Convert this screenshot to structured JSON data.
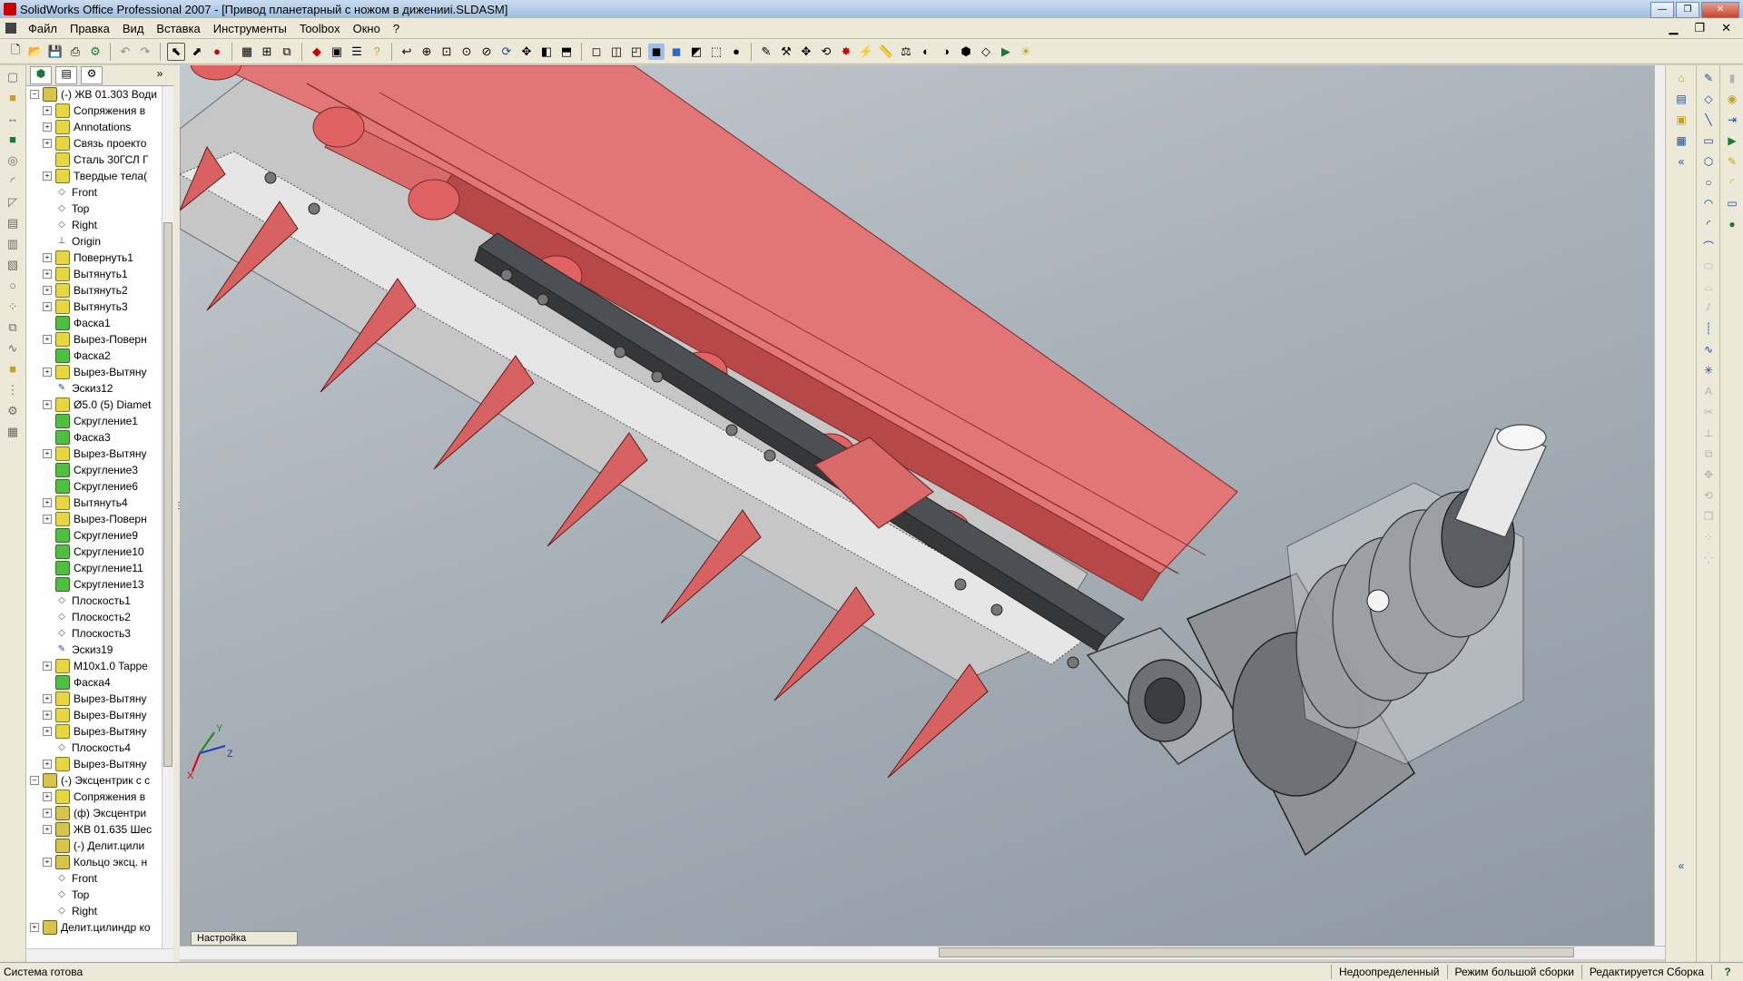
{
  "window": {
    "title": "SolidWorks Office Professional 2007 - [Привод планетарный с ножом в  диженииi.SLDASM]",
    "minimize": "—",
    "maximize": "❐",
    "close": "✕"
  },
  "menu": {
    "items": [
      "Файл",
      "Правка",
      "Вид",
      "Вставка",
      "Инструменты",
      "Toolbox",
      "Окно",
      "?"
    ]
  },
  "feature_tree": {
    "items": [
      {
        "label": "(-) ЖВ 01.303 Води",
        "icon": "assembly-icon",
        "level": 0,
        "expand": "−"
      },
      {
        "label": "Сопряжения в",
        "icon": "mates-icon",
        "level": 1,
        "expand": "+"
      },
      {
        "label": "Annotations",
        "icon": "annotations-icon",
        "level": 1,
        "expand": "+"
      },
      {
        "label": "Связь проекто",
        "icon": "design-binder-icon",
        "level": 1,
        "expand": "+"
      },
      {
        "label": "Сталь 30ГСЛ Г",
        "icon": "material-icon",
        "level": 1,
        "expand": ""
      },
      {
        "label": "Твердые тела(",
        "icon": "solid-bodies-icon",
        "level": 1,
        "expand": "+"
      },
      {
        "label": "Front",
        "icon": "plane-icon",
        "level": 1,
        "expand": ""
      },
      {
        "label": "Top",
        "icon": "plane-icon",
        "level": 1,
        "expand": ""
      },
      {
        "label": "Right",
        "icon": "plane-icon",
        "level": 1,
        "expand": ""
      },
      {
        "label": "Origin",
        "icon": "origin-icon",
        "level": 1,
        "expand": ""
      },
      {
        "label": "Повернуть1",
        "icon": "revolve-icon",
        "level": 1,
        "expand": "+"
      },
      {
        "label": "Вытянуть1",
        "icon": "extrude-icon",
        "level": 1,
        "expand": "+"
      },
      {
        "label": "Вытянуть2",
        "icon": "extrude-icon",
        "level": 1,
        "expand": "+"
      },
      {
        "label": "Вытянуть3",
        "icon": "extrude-icon",
        "level": 1,
        "expand": "+"
      },
      {
        "label": "Фаска1",
        "icon": "chamfer-icon",
        "level": 1,
        "expand": ""
      },
      {
        "label": "Вырез-Поверн",
        "icon": "cut-revolve-icon",
        "level": 1,
        "expand": "+"
      },
      {
        "label": "Фаска2",
        "icon": "chamfer-icon",
        "level": 1,
        "expand": ""
      },
      {
        "label": "Вырез-Вытяну",
        "icon": "cut-extrude-icon",
        "level": 1,
        "expand": "+"
      },
      {
        "label": "Эскиз12",
        "icon": "sketch-icon",
        "level": 1,
        "expand": ""
      },
      {
        "label": "Ø5.0 (5) Diamet",
        "icon": "hole-icon",
        "level": 1,
        "expand": "+"
      },
      {
        "label": "Скругление1",
        "icon": "fillet-icon",
        "level": 1,
        "expand": ""
      },
      {
        "label": "Фаска3",
        "icon": "chamfer-icon",
        "level": 1,
        "expand": ""
      },
      {
        "label": "Вырез-Вытяну",
        "icon": "cut-extrude-icon",
        "level": 1,
        "expand": "+"
      },
      {
        "label": "Скругление3",
        "icon": "fillet-icon",
        "level": 1,
        "expand": ""
      },
      {
        "label": "Скругление6",
        "icon": "fillet-icon",
        "level": 1,
        "expand": ""
      },
      {
        "label": "Вытянуть4",
        "icon": "extrude-icon",
        "level": 1,
        "expand": "+"
      },
      {
        "label": "Вырез-Поверн",
        "icon": "cut-revolve-icon",
        "level": 1,
        "expand": "+"
      },
      {
        "label": "Скругление9",
        "icon": "fillet-icon",
        "level": 1,
        "expand": ""
      },
      {
        "label": "Скругление10",
        "icon": "fillet-icon",
        "level": 1,
        "expand": ""
      },
      {
        "label": "Скругление11",
        "icon": "fillet-icon",
        "level": 1,
        "expand": ""
      },
      {
        "label": "Скругление13",
        "icon": "fillet-icon",
        "level": 1,
        "expand": ""
      },
      {
        "label": "Плоскость1",
        "icon": "plane-icon",
        "level": 1,
        "expand": ""
      },
      {
        "label": "Плоскость2",
        "icon": "plane-icon",
        "level": 1,
        "expand": ""
      },
      {
        "label": "Плоскость3",
        "icon": "plane-icon",
        "level": 1,
        "expand": ""
      },
      {
        "label": "Эскиз19",
        "icon": "sketch-icon",
        "level": 1,
        "expand": ""
      },
      {
        "label": "M10x1.0 Tappe",
        "icon": "hole-icon",
        "level": 1,
        "expand": "+"
      },
      {
        "label": "Фаска4",
        "icon": "chamfer-icon",
        "level": 1,
        "expand": ""
      },
      {
        "label": "Вырез-Вытяну",
        "icon": "cut-extrude-icon",
        "level": 1,
        "expand": "+"
      },
      {
        "label": "Вырез-Вытяну",
        "icon": "cut-extrude-icon",
        "level": 1,
        "expand": "+"
      },
      {
        "label": "Вырез-Вытяну",
        "icon": "cut-extrude-icon",
        "level": 1,
        "expand": "+"
      },
      {
        "label": "Плоскость4",
        "icon": "plane-icon",
        "level": 1,
        "expand": ""
      },
      {
        "label": "Вырез-Вытяну",
        "icon": "cut-extrude-icon",
        "level": 1,
        "expand": "+"
      },
      {
        "label": "(-) Эксцентрик с с",
        "icon": "assembly-icon",
        "level": 0,
        "expand": "−"
      },
      {
        "label": "Сопряжения в",
        "icon": "mates-icon",
        "level": 1,
        "expand": "+"
      },
      {
        "label": "(ф) Эксцентри",
        "icon": "part-icon",
        "level": 1,
        "expand": "+"
      },
      {
        "label": "ЖВ 01.635 Шес",
        "icon": "part-icon",
        "level": 1,
        "expand": "+"
      },
      {
        "label": "(-) Делит.цили",
        "icon": "part-icon",
        "level": 1,
        "expand": ""
      },
      {
        "label": "Кольцо эксц. н",
        "icon": "part-icon",
        "level": 1,
        "expand": "+"
      },
      {
        "label": "Front",
        "icon": "plane-icon",
        "level": 1,
        "expand": ""
      },
      {
        "label": "Top",
        "icon": "plane-icon",
        "level": 1,
        "expand": ""
      },
      {
        "label": "Right",
        "icon": "plane-icon",
        "level": 1,
        "expand": ""
      },
      {
        "label": "Делит.цилиндр ко",
        "icon": "part-icon",
        "level": 0,
        "expand": "+"
      }
    ]
  },
  "viewport": {
    "configuration_tab": "Настройка",
    "triad_axes": [
      "X",
      "Y",
      "Z"
    ]
  },
  "status": {
    "left": "Система готова",
    "cells": [
      "Недоопределенный",
      "Режим большой сборки",
      "Редактируется Сборка"
    ],
    "help": "?"
  },
  "colors": {
    "part_red": "#e07070",
    "part_dark_red": "#b84848",
    "blade_bar": "#505458",
    "gray_plate": "#c8c8c8",
    "gearbox": "#9a9ea2"
  }
}
